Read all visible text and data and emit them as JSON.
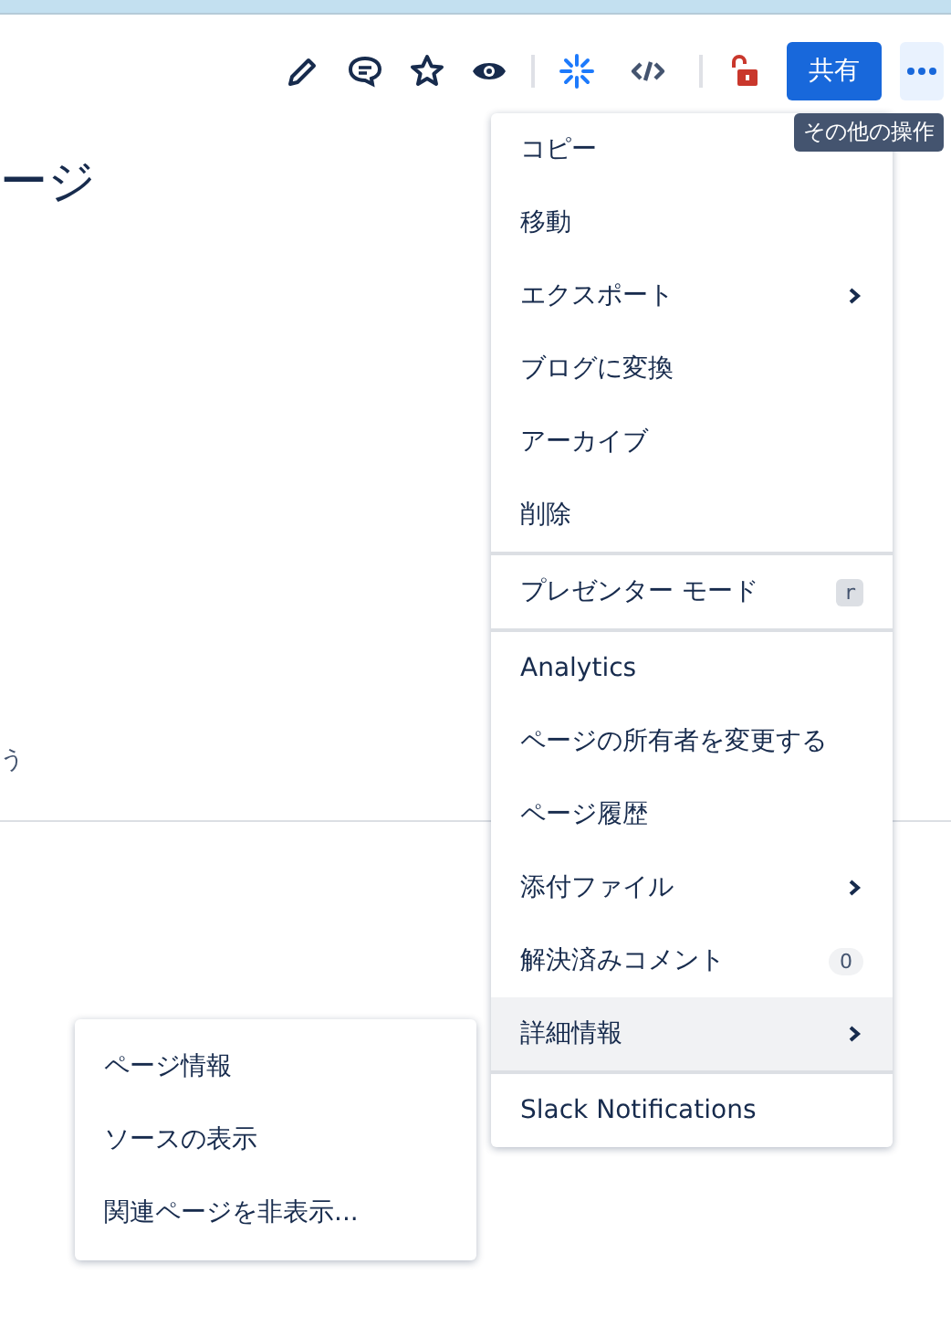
{
  "page": {
    "title_fragment": "ージ",
    "text_fragment": "う"
  },
  "toolbar": {
    "share_button": "共有",
    "more_button_tooltip": "その他の操作"
  },
  "menu": {
    "groups": [
      {
        "items": [
          {
            "label": "コピー",
            "kind": "plain",
            "selected": false
          },
          {
            "label": "移動",
            "kind": "plain",
            "selected": false
          },
          {
            "label": "エクスポート",
            "kind": "submenu",
            "selected": false
          },
          {
            "label": "ブログに変換",
            "kind": "plain",
            "selected": false
          },
          {
            "label": "アーカイブ",
            "kind": "plain",
            "selected": false
          },
          {
            "label": "削除",
            "kind": "plain",
            "selected": false
          }
        ]
      },
      {
        "items": [
          {
            "label": "プレゼンター モード",
            "kind": "shortcut",
            "shortcut": "r",
            "selected": false
          }
        ]
      },
      {
        "items": [
          {
            "label": "Analytics",
            "kind": "plain",
            "selected": false
          },
          {
            "label": "ページの所有者を変更する",
            "kind": "plain",
            "selected": false
          },
          {
            "label": "ページ履歴",
            "kind": "plain",
            "selected": false
          },
          {
            "label": "添付ファイル",
            "kind": "submenu",
            "selected": false
          },
          {
            "label": "解決済みコメント",
            "kind": "count",
            "count": "0",
            "selected": false
          },
          {
            "label": "詳細情報",
            "kind": "submenu",
            "selected": true
          }
        ]
      },
      {
        "items": [
          {
            "label": "Slack Notifications",
            "kind": "plain",
            "selected": false
          }
        ]
      }
    ]
  },
  "submenu": {
    "items": [
      {
        "label": "ページ情報",
        "selected": false
      },
      {
        "label": "ソースの表示",
        "selected": false
      },
      {
        "label": "関連ページを非表示...",
        "selected": false
      }
    ]
  }
}
